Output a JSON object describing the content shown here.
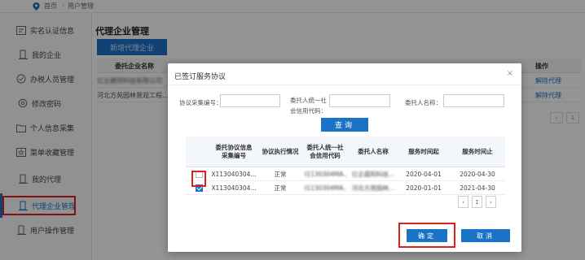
{
  "breadcrumb": {
    "home": "首页",
    "separator": "›",
    "current": "用户管理"
  },
  "sidebar": {
    "items": [
      {
        "label": "实名认证信息",
        "icon": "id-card-icon"
      },
      {
        "label": "我的企业",
        "icon": "building-icon"
      },
      {
        "label": "办税人员管理",
        "icon": "check-circle-icon"
      },
      {
        "label": "修改密码",
        "icon": "gear-icon"
      },
      {
        "label": "个人信息采集",
        "icon": "folder-icon"
      },
      {
        "label": "菜单收藏管理",
        "icon": "star-icon"
      },
      {
        "label": "我的代理",
        "icon": "building-icon"
      },
      {
        "label": "代理企业管理",
        "icon": "building-icon",
        "active": true
      },
      {
        "label": "用户操作管理",
        "icon": "building-icon"
      }
    ]
  },
  "main": {
    "title": "代理企业管理",
    "add_button": "新增代理企业",
    "columns": {
      "company_name": "委托企业名称",
      "operation": "操作"
    },
    "rows": [
      {
        "company": "亿企晨阳科技有限公司",
        "action": "解除代理"
      },
      {
        "company": "河北方苑园林景观工程...",
        "action": "解除代理"
      }
    ],
    "pager": [
      "‹",
      "1"
    ]
  },
  "modal": {
    "title": "已签订服务协议",
    "close": "×",
    "filters": {
      "agreement_no_label": "协议采集编号：",
      "credit_code_label_1": "委托人统一社",
      "credit_code_label_2": "会信用代码：",
      "client_name_label": "委托人名称："
    },
    "query_button": "查询",
    "columns": {
      "agreement_no": "委托协议信息采集编号",
      "status": "协议执行情况",
      "credit_code": "委托人统一社会信用代码",
      "client_name": "委托人名称",
      "start": "服务时间起",
      "end": "服务时间止"
    },
    "rows": [
      {
        "checked": false,
        "agreement_no": "X113040304...",
        "status": "正常",
        "credit_code": "91130304MA...",
        "client_name": "亿企晨阳科技...",
        "start": "2020-04-01",
        "end": "2020-04-30"
      },
      {
        "checked": true,
        "agreement_no": "X113040304...",
        "status": "正常",
        "credit_code": "91130304MA...",
        "client_name": "河北方苑园林...",
        "start": "2020-01-01",
        "end": "2021-04-30"
      }
    ],
    "pager": [
      "‹",
      "1",
      "›"
    ],
    "ok_button": "确定",
    "cancel_button": "取消"
  },
  "colors": {
    "primary": "#1a73c7",
    "highlight": "#e02020"
  }
}
